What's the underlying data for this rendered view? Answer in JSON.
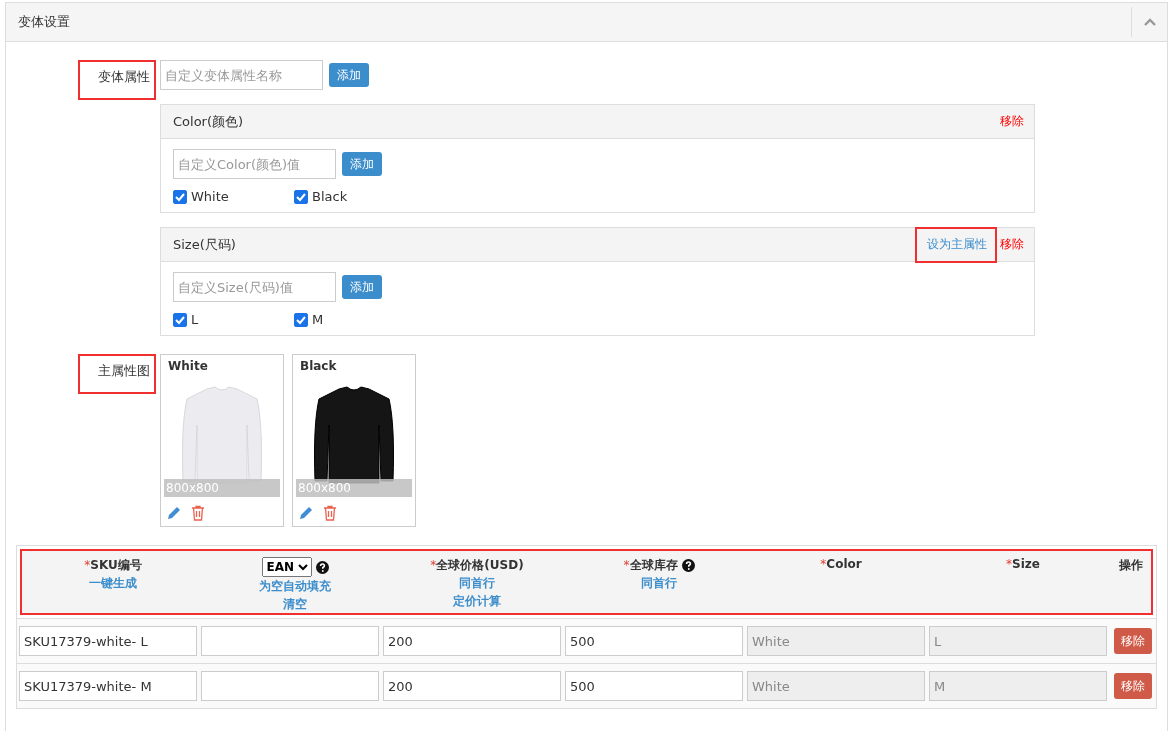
{
  "panel": {
    "title": "变体设置",
    "collapsed": false
  },
  "variant_attributes": {
    "label": "变体属性",
    "highlighted": true,
    "name_field": {
      "placeholder": "自定义变体属性名称"
    },
    "add_button": "添加",
    "attributes": [
      {
        "name": "Color(颜色)",
        "remove_link": "移除",
        "value_field": {
          "placeholder": "自定义Color(颜色)值"
        },
        "add_button": "添加",
        "values": [
          {
            "label": "White",
            "checked": true
          },
          {
            "label": "Black",
            "checked": true
          }
        ]
      },
      {
        "name": "Size(尺码)",
        "set_main_link": "设为主属性",
        "set_main_highlighted": true,
        "remove_link": "移除",
        "value_field": {
          "placeholder": "自定义Size(尺码)值"
        },
        "add_button": "添加",
        "values": [
          {
            "label": "L",
            "checked": true
          },
          {
            "label": "M",
            "checked": true
          }
        ]
      }
    ]
  },
  "main_images": {
    "label": "主属性图",
    "highlighted": true,
    "images": [
      {
        "title": "White",
        "size": "800x800",
        "kind": "light"
      },
      {
        "title": "Black",
        "size": "800x800",
        "kind": "dark"
      }
    ]
  },
  "sku_table": {
    "header_highlighted": true,
    "columns": [
      {
        "required_mark": "*",
        "title": "SKU编号",
        "links": [
          "一键生成"
        ]
      },
      {
        "select": "EAN",
        "help": true,
        "links": [
          "为空自动填充",
          "清空"
        ]
      },
      {
        "required_mark": "*",
        "title": "全球价格(USD)",
        "links": [
          "同首行",
          "定价计算"
        ]
      },
      {
        "required_mark": "*",
        "title": "全球库存",
        "help": true,
        "links": [
          "同首行"
        ]
      },
      {
        "required_mark": "*",
        "title": "Color"
      },
      {
        "required_mark": "*",
        "title": "Size"
      },
      {
        "title": "操作"
      }
    ],
    "rows": [
      {
        "cells": [
          {
            "value": "SKU17379-white- L",
            "disabled": false
          },
          {
            "disabled": false
          },
          {
            "value": "200",
            "disabled": false
          },
          {
            "value": "500",
            "disabled": false
          },
          {
            "value": "White",
            "disabled": true
          },
          {
            "value": "L",
            "disabled": true
          }
        ],
        "remove_button": "移除"
      },
      {
        "cells": [
          {
            "value": "SKU17379-white- M",
            "disabled": false
          },
          {
            "disabled": false
          },
          {
            "value": "200",
            "disabled": false
          },
          {
            "value": "500",
            "disabled": false
          },
          {
            "value": "White",
            "disabled": true
          },
          {
            "value": "M",
            "disabled": true
          }
        ],
        "remove_button": "移除"
      }
    ]
  }
}
